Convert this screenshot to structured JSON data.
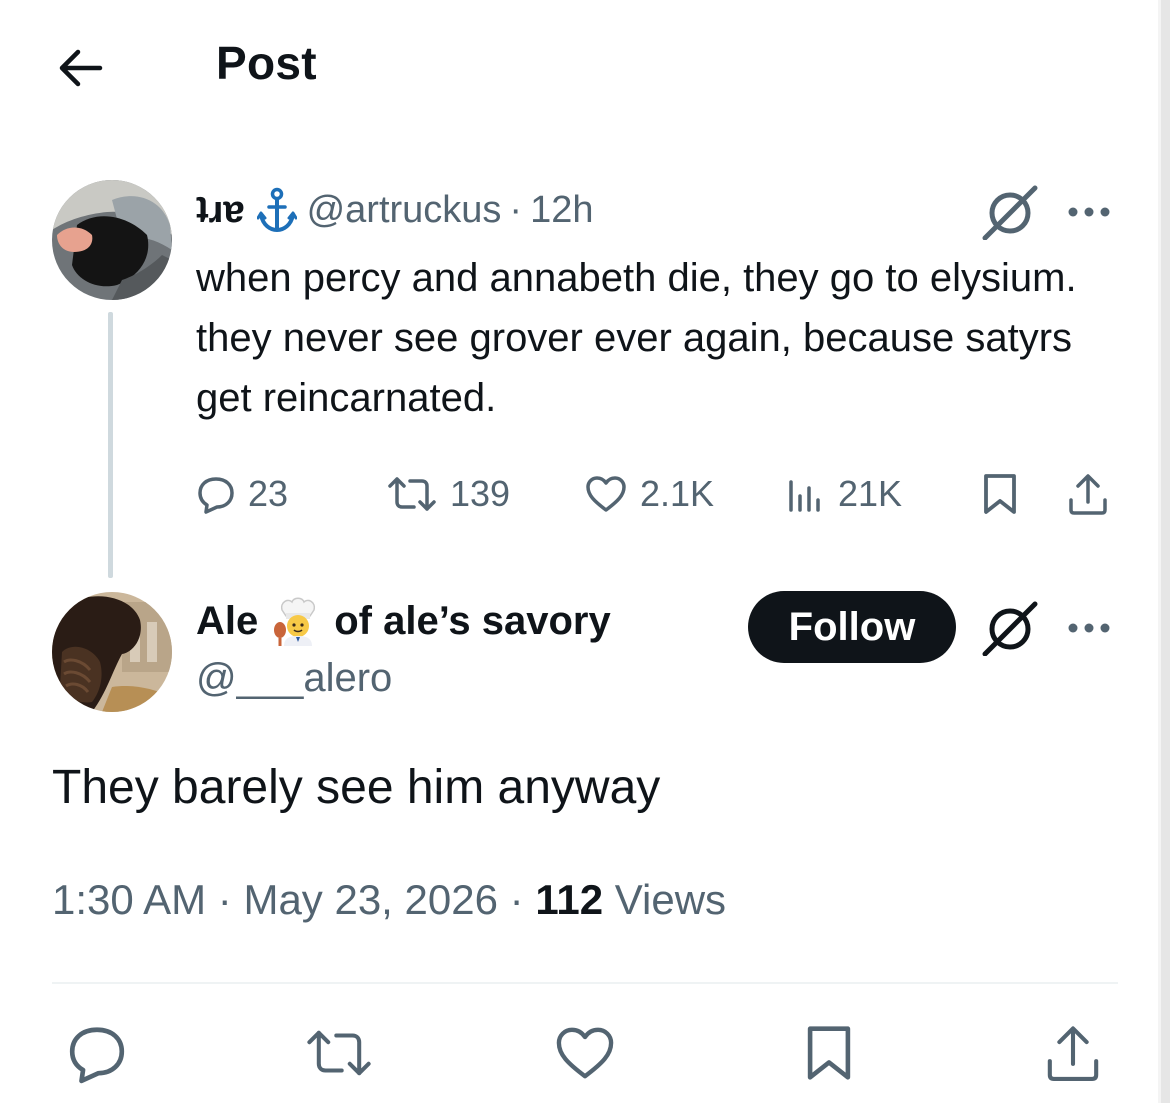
{
  "header": {
    "title": "Post"
  },
  "original_post": {
    "display_name": "ʇɹɐ",
    "emoji": "anchor",
    "handle": "@artruckus",
    "separator": "·",
    "time": "12h",
    "text": "when percy and annabeth die, they go to elysium. they never see grover ever again, because satyrs get reincarnated.",
    "stats": {
      "replies": "23",
      "reposts": "139",
      "likes": "2.1K",
      "views": "21K"
    }
  },
  "reply": {
    "display_name_start": "Ale",
    "emoji": "cook",
    "display_name_end": "of ale’s savory",
    "handle": "@___alero",
    "follow_label": "Follow",
    "text": "They barely see him anyway",
    "time": "1:30 AM",
    "separator": "·",
    "date": "May 23, 2026",
    "views_count": "112",
    "views_label": "Views"
  },
  "colors": {
    "text": "#0f1419",
    "secondary": "#536471",
    "anchor": "#1d6fb8",
    "divider": "#eff3f4"
  }
}
